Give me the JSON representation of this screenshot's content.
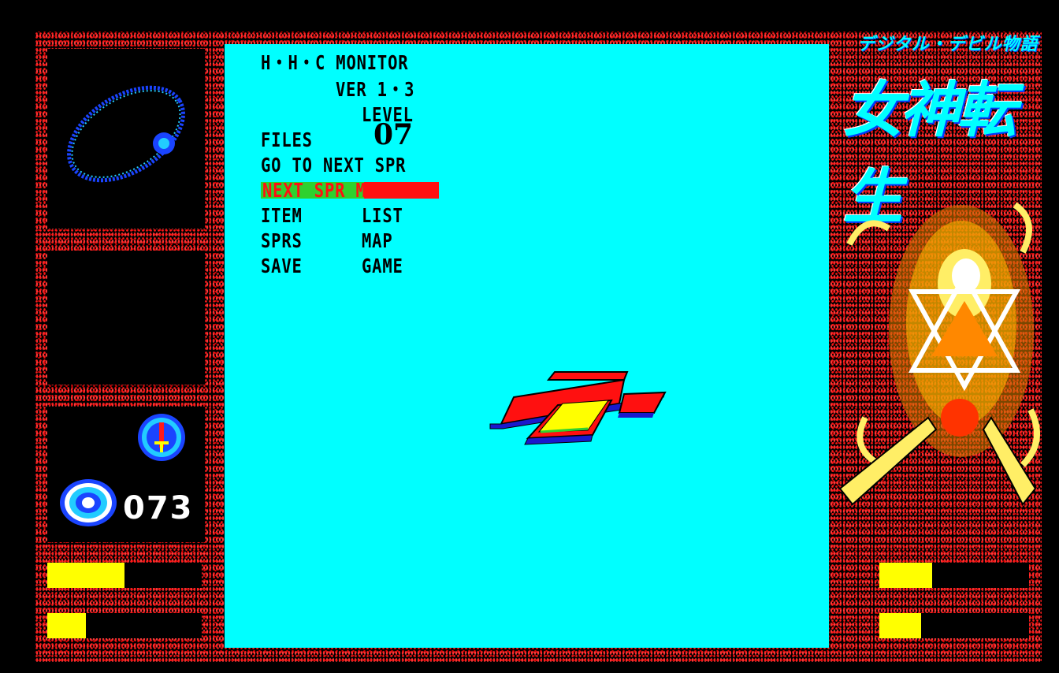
{
  "monitor": {
    "title": "H・H・C MONITOR",
    "version": "VER 1・3",
    "level_label": "LEVEL",
    "level_value": "07",
    "files_label": "FILES",
    "status_line": "GO TO NEXT SPR",
    "highlight": "NEXT SPR MAP"
  },
  "menu": {
    "items": [
      {
        "label": "ITEM"
      },
      {
        "label": "LIST"
      },
      {
        "label": "SPRS"
      },
      {
        "label": "MAP"
      },
      {
        "label": "SAVE"
      },
      {
        "label": "GAME"
      }
    ]
  },
  "hud": {
    "counter": "073",
    "left_bar_1": 0.5,
    "left_bar_2": 0.25,
    "right_bar_1": 0.35,
    "right_bar_2": 0.28
  },
  "title_art": {
    "subtitle": "デジタル・デビル物語",
    "main": "女神転生"
  },
  "colors": {
    "viewport": "#00ffff",
    "border": "#ff1a1a",
    "bar": "#ffff00",
    "highlight_green": "#2ed12e",
    "highlight_red": "#ff1010"
  }
}
